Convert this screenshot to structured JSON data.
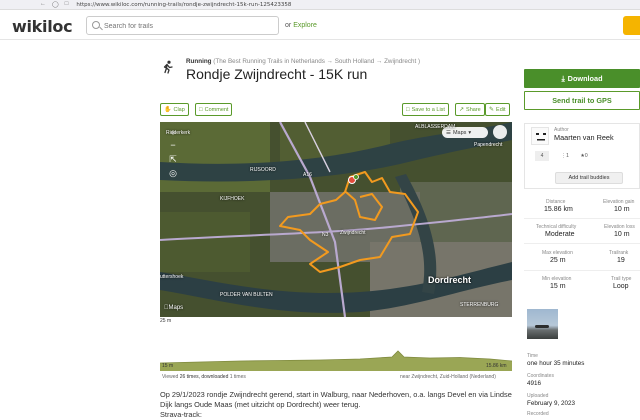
{
  "browser": {
    "url": "https://www.wikiloc.com/running-trails/rondje-zwijndrecht-15k-run-125423358"
  },
  "header": {
    "logo_text": "wikiloc",
    "search_placeholder": "Search for trails",
    "explore_prefix": "or",
    "explore_label": "Explore"
  },
  "trail": {
    "activity": "Running",
    "breadcrumb": "(The Best Running Trails in Netherlands → South Holland → Zwijndrecht )",
    "title": "Rondje Zwijndrecht - 15K run"
  },
  "actions": {
    "clap": "Clap",
    "comment": "Comment",
    "save": "Save to a List",
    "share": "Share",
    "edit": "Edit"
  },
  "map": {
    "maps_button": "Maps",
    "labels": {
      "papendrecht": "Papendrecht",
      "alblasserdam": "ALBLASSERDAM",
      "rijsoord": "RIJSOORD",
      "kijfhoek": "KIJFHOEK",
      "zwijndrecht": "Zwijndrecht",
      "dordrecht": "Dordrecht",
      "sterrenburg": "STERRENBURG",
      "polder": "POLDER VAN BULTEN",
      "ridderkerk": "Ridderkerk",
      "puttershoek": "uttershoek",
      "highway1": "A16",
      "highway2": "N3"
    },
    "attribution": "Maps",
    "scale": "25 m"
  },
  "elevation": {
    "min_label": "15 m",
    "max_label": "15.86 km",
    "viewed_prefix": "Viewed",
    "viewed_count": "26 times,",
    "downloaded_label": "downloaded",
    "downloaded_count": "1 times",
    "near": "near Zwijndrecht, Zuid-Holland (Nederland)"
  },
  "description": {
    "text": "Op 29/1/2023 rondje Zwijndrecht gerend, start in Walburg, naar Nederhoven, o.a. langs Devel en via Lindse Dijk langs Oude Maas (met uitzicht op Dordrecht) weer terug.",
    "cutoff": "Strava-track:"
  },
  "sidebar": {
    "download": "Download",
    "send": "Send trail to GPS",
    "author_key": "Author",
    "author_name": "Maarten van Reek",
    "count1": "4",
    "count2": "1",
    "count3": "0",
    "buddies": "Add trail buddies",
    "stats": {
      "distance_k": "Distance",
      "distance_v": "15.86 km",
      "gain_k": "Elevation gain",
      "gain_v": "10 m",
      "difficulty_k": "Technical difficulty",
      "difficulty_v": "Moderate",
      "loss_k": "Elevation loss",
      "loss_v": "10 m",
      "max_k": "Max elevation",
      "max_v": "25 m",
      "trailrank_k": "Trailrank",
      "trailrank_v": "19",
      "min_k": "Min elevation",
      "min_v": "15 m",
      "type_k": "Trail type",
      "type_v": "Loop"
    },
    "time_k": "Time",
    "time_v": "one hour 35 minutes",
    "coords_k": "Coordinates",
    "coords_v": "4916",
    "uploaded_k": "Uploaded",
    "uploaded_v": "February 9, 2023",
    "recorded_k": "Recorded"
  },
  "colors": {
    "brand_green": "#5a9a2a",
    "track_orange": "#f29a1f",
    "cta_yellow": "#f5b400"
  }
}
